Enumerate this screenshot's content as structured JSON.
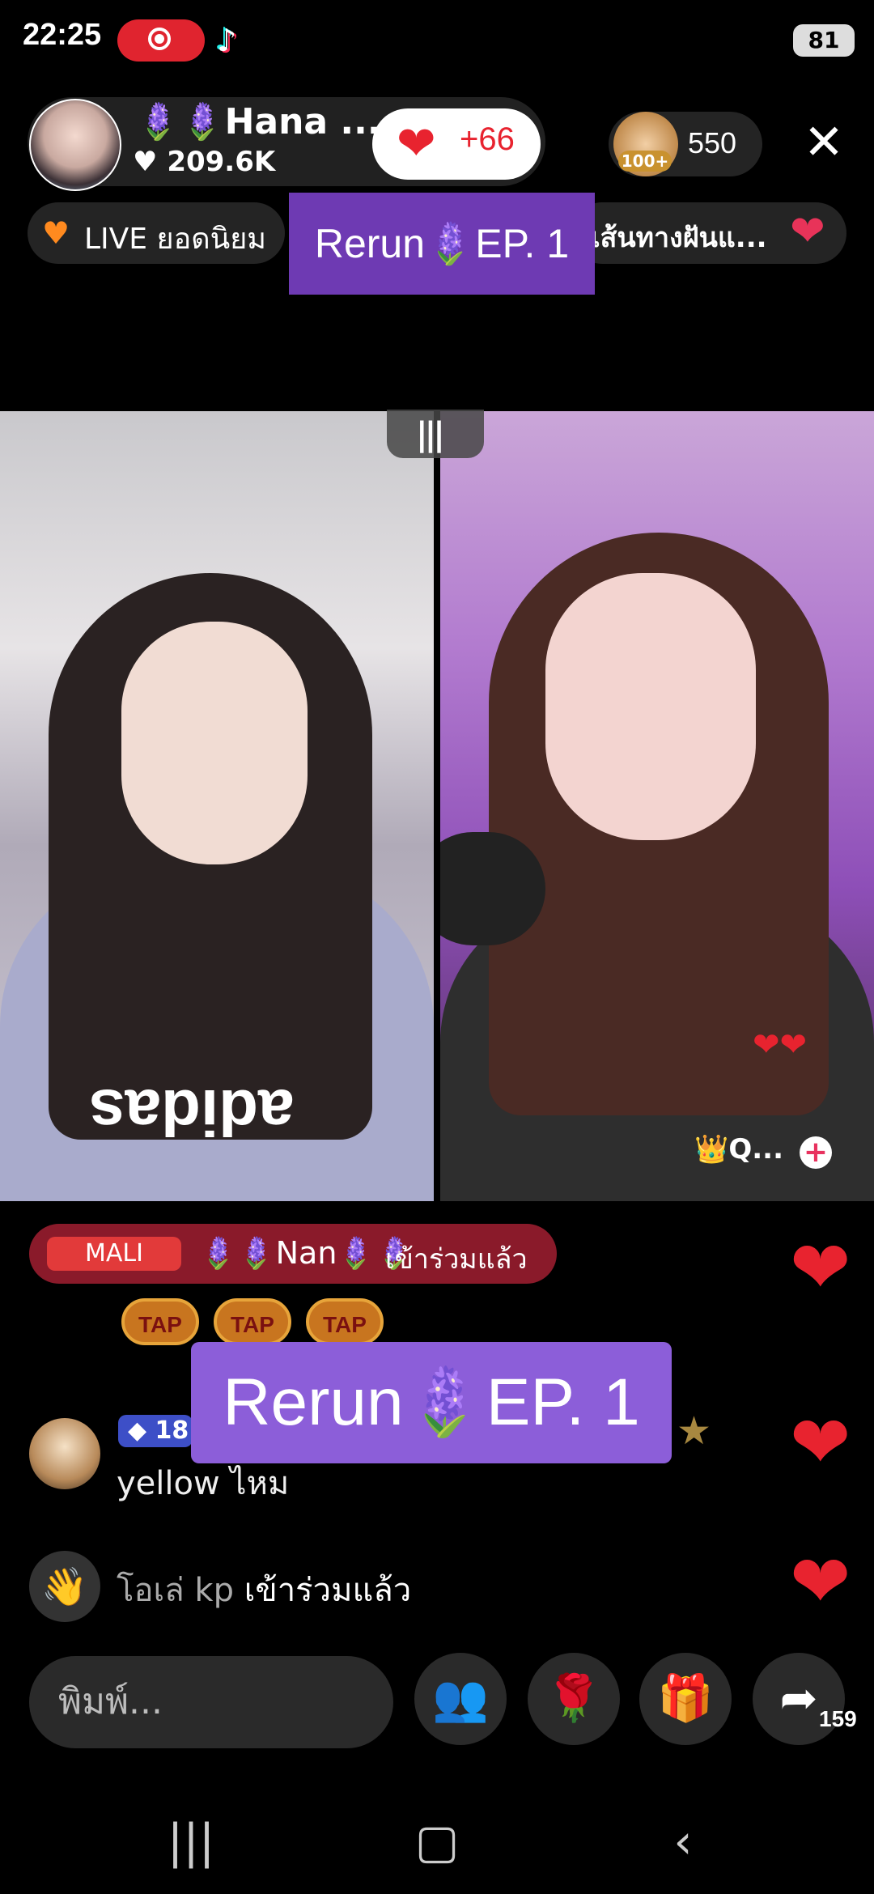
{
  "status_bar": {
    "time": "22:25",
    "battery": "81"
  },
  "header": {
    "host_name": "🪻🪻Hana ...",
    "host_likes": "♥ 209.6K",
    "like_gain": "+66",
    "viewer_count": "550",
    "viewer_badge": "100+"
  },
  "tags": {
    "live_label": "LIVE ยอดนิยม",
    "route_label": "เส้นทางฝันแ..."
  },
  "overlays": {
    "rerun_small": "Rerun🪻EP. 1",
    "rerun_big": "Rerun🪻EP. 1"
  },
  "guest": {
    "tag": "👑Q..."
  },
  "chat": {
    "join_badge": "MALI",
    "join_name": "🪻🪻Nan🪻🪻",
    "join_action": "เข้าร่วมแล้ว",
    "tap_labels": [
      "TAP",
      "TAP",
      "TAP"
    ],
    "comment_level": "18",
    "comment_text": "yellow ไหม",
    "wave_user": "โอเล่ kp",
    "wave_action": "เข้าร่วมแล้ว"
  },
  "bottom": {
    "input_placeholder": "พิมพ์...",
    "share_count": "159"
  },
  "colors": {
    "accent_purple": "#8c5ed9",
    "heart_red": "#e8232f"
  },
  "icons": [
    "record-icon",
    "tiktok-icon",
    "heart-icon",
    "close-icon",
    "people-icon",
    "rose-icon",
    "gift-icon",
    "share-icon",
    "wave-icon"
  ]
}
